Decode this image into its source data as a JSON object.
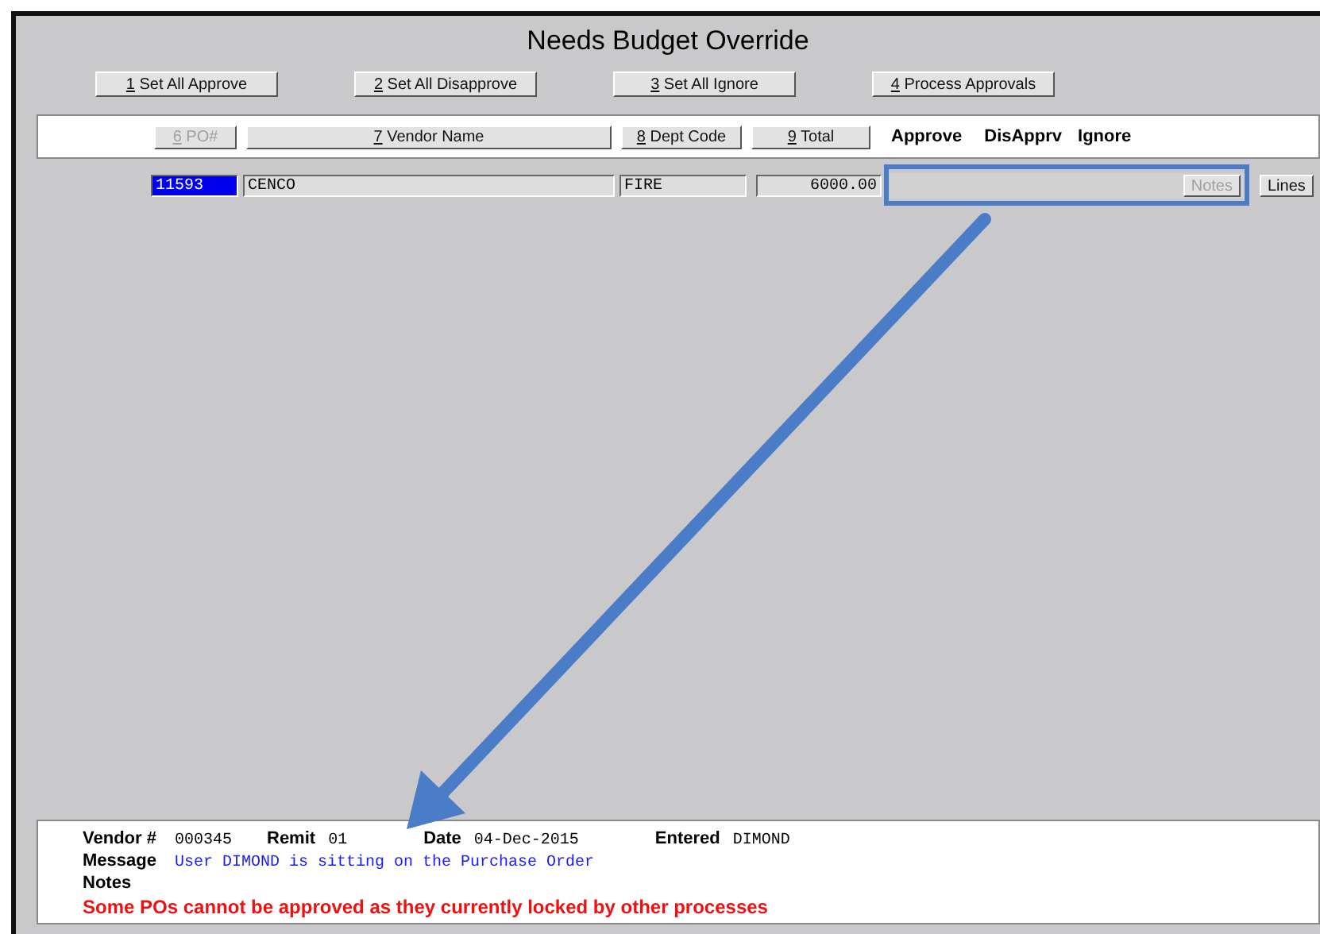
{
  "window": {
    "title": "Needs Budget Override"
  },
  "actions": [
    {
      "key": "1",
      "label": " Set All Approve"
    },
    {
      "key": "2",
      "label": " Set All Disapprove"
    },
    {
      "key": "3",
      "label": " Set All Ignore"
    },
    {
      "key": "4",
      "label": " Process Approvals"
    }
  ],
  "columns": [
    {
      "kind": "button",
      "key": "6",
      "label": " PO#",
      "disabled": true
    },
    {
      "kind": "button",
      "key": "7",
      "label": " Vendor Name",
      "disabled": false
    },
    {
      "kind": "button",
      "key": "8",
      "label": " Dept Code",
      "disabled": false
    },
    {
      "kind": "button",
      "key": "9",
      "label": " Total",
      "disabled": false
    },
    {
      "kind": "text",
      "label": "Approve"
    },
    {
      "kind": "text",
      "label": "DisApprv"
    },
    {
      "kind": "text",
      "label": "Ignore"
    }
  ],
  "rows": [
    {
      "po": "11593",
      "selected": true,
      "vendor": "CENCO",
      "dept": "FIRE",
      "total": "6000.00",
      "notes": {
        "label": "Notes",
        "disabled": true
      },
      "lines": {
        "label": "Lines",
        "disabled": false
      }
    }
  ],
  "details": {
    "vendor_label": "Vendor #",
    "vendor": "000345",
    "remit_label": "Remit",
    "remit": "01",
    "date_label": "Date",
    "date": "04-Dec-2015",
    "entered_label": "Entered",
    "entered": "DIMOND",
    "message_label": "Message",
    "message": "User DIMOND is sitting on the Purchase Order",
    "notes_label": "Notes",
    "error": "Some POs cannot be approved as they currently locked by other processes"
  }
}
